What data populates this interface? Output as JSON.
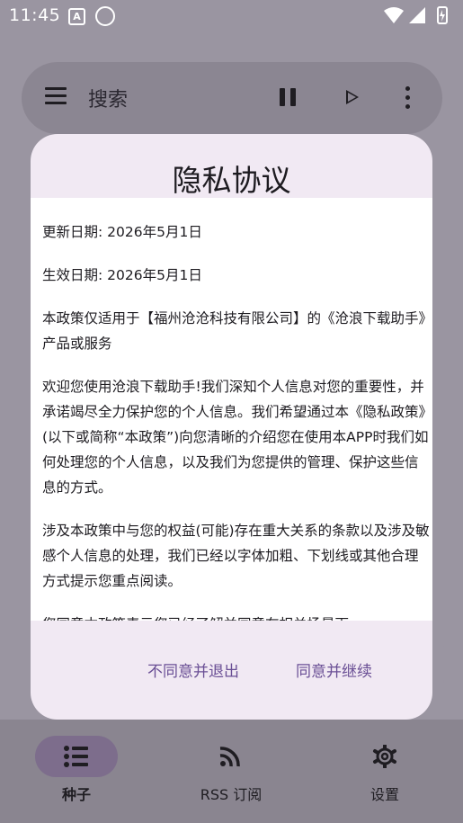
{
  "status_bar": {
    "time": "11:45",
    "notif_icon": "A"
  },
  "search_bar": {
    "label": "搜索"
  },
  "dialog": {
    "title": "隐私协议",
    "paragraphs": [
      "更新日期: 2026年5月1日",
      "生效日期: 2026年5月1日",
      "本政策仅适用于【福州沧沧科技有限公司】的《沧浪下载助手》产品或服务",
      "欢迎您使用沧浪下载助手!我们深知个人信息对您的重要性，并承诺竭尽全力保护您的个人信息。我们希望通过本《隐私政策》(以下或简称“本政策”)向您清晰的介绍您在使用本APP时我们如何处理您的个人信息，以及我们为您提供的管理、保护这些信息的方式。",
      "涉及本政策中与您的权益(可能)存在重大关系的条款以及涉及敏感个人信息的处理，我们已经以字体加粗、下划线或其他合理方式提示您重点阅读。",
      "您同意本政策表示您已经了解并同意在相关场景下"
    ],
    "decline_label": "不同意并退出",
    "accept_label": "同意并继续"
  },
  "bottom_nav": {
    "items": [
      {
        "label": "种子",
        "icon": "list-icon",
        "selected": true
      },
      {
        "label": "RSS 订阅",
        "icon": "rss-icon",
        "selected": false
      },
      {
        "label": "设置",
        "icon": "gear-icon",
        "selected": false
      }
    ]
  }
}
